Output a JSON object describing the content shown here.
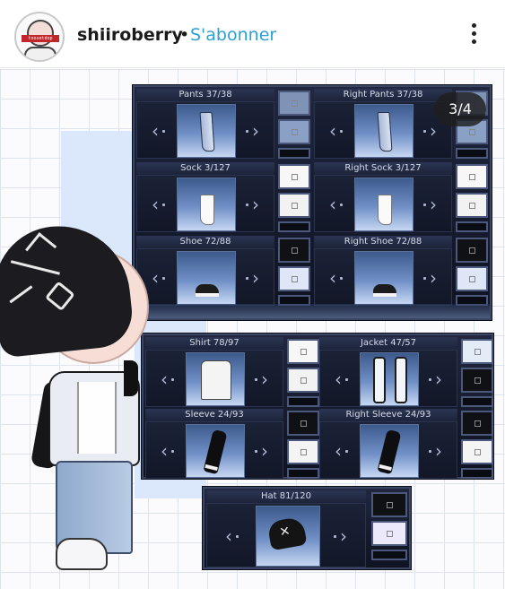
{
  "header": {
    "username": "shiiroberry",
    "separator": "•",
    "follow_label": "S'abonner",
    "avatar_text": "toosetdop"
  },
  "pager": {
    "label": "3/4"
  },
  "panels": {
    "top": [
      {
        "title": "Pants 37/38",
        "item": "pants"
      },
      {
        "title": "Right Pants 37/38",
        "item": "pants"
      },
      {
        "title": "Sock 3/127",
        "item": "sock"
      },
      {
        "title": "Right Sock 3/127",
        "item": "sock"
      },
      {
        "title": "Shoe 72/88",
        "item": "shoe"
      },
      {
        "title": "Right Shoe 72/88",
        "item": "shoe"
      }
    ],
    "mid": [
      {
        "title": "Shirt 78/97",
        "item": "shirt"
      },
      {
        "title": "Jacket 47/57",
        "item": "jacket"
      },
      {
        "title": "Sleeve 24/93",
        "item": "sleeve"
      },
      {
        "title": "Right Sleeve 24/93",
        "item": "sleeve"
      }
    ],
    "hat": [
      {
        "title": "Hat 81/120",
        "item": "hat"
      }
    ]
  },
  "icons": {
    "prev": "chevron-left-icon",
    "next": "chevron-right-icon",
    "more": "more-vertical-icon"
  },
  "colors": {
    "follow": "#2b9fd8",
    "panel_bg": "#151a2c",
    "panel_border": "#3a4663",
    "grid": "#dfe3ee"
  }
}
